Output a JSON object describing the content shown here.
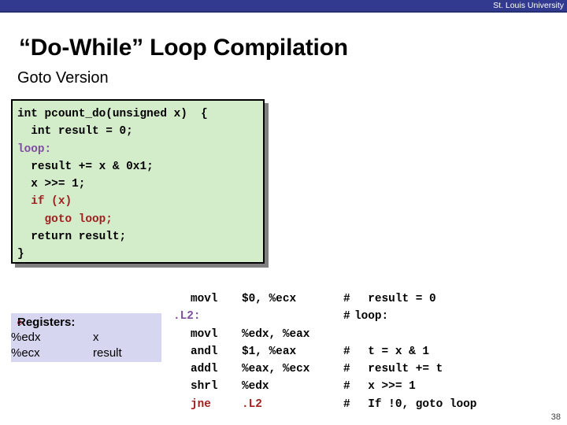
{
  "banner": {
    "institution": "St. Louis University"
  },
  "title": "“Do-While” Loop Compilation",
  "subtitle": "Goto Version",
  "colors": {
    "banner_bg": "#313a8e",
    "code_bg": "#d3ecca",
    "registers_bg": "#d6d6f0",
    "label_purple": "#7e4fa0",
    "keyword_red": "#a32020",
    "bullet_maroon": "#9c2b3f"
  },
  "code_block": {
    "language": "c",
    "lines": [
      {
        "segments": [
          {
            "text": "int pcount_do(unsigned x)  {",
            "style": "plain"
          }
        ]
      },
      {
        "segments": [
          {
            "text": "  int result = 0;",
            "style": "plain"
          }
        ]
      },
      {
        "segments": [
          {
            "text": "loop:",
            "style": "label"
          }
        ]
      },
      {
        "segments": [
          {
            "text": "  result += x & 0x1;",
            "style": "plain"
          }
        ]
      },
      {
        "segments": [
          {
            "text": "  x >>= 1;",
            "style": "plain"
          }
        ]
      },
      {
        "segments": [
          {
            "text": "  if (x)",
            "style": "keyword"
          }
        ]
      },
      {
        "segments": [
          {
            "text": "    goto loop;",
            "style": "keyword"
          }
        ]
      },
      {
        "segments": [
          {
            "text": "  return result;",
            "style": "plain"
          }
        ]
      },
      {
        "segments": [
          {
            "text": "}",
            "style": "plain"
          }
        ]
      }
    ]
  },
  "registers_callout": {
    "heading": "Registers:",
    "rows": [
      {
        "name": "%edx",
        "value": "x"
      },
      {
        "name": "%ecx",
        "value": "result"
      }
    ]
  },
  "assembly": {
    "lines": [
      {
        "label": "",
        "mnemonic": "movl",
        "operands": "$0, %ecx",
        "hash": "#",
        "comment": "  result = 0",
        "style": "plain"
      },
      {
        "label": ".L2:",
        "mnemonic": "",
        "operands": "",
        "hash": "#",
        "comment": "loop:",
        "style": "label",
        "comment_tight": true
      },
      {
        "label": "",
        "mnemonic": "movl",
        "operands": "%edx, %eax",
        "hash": "",
        "comment": "",
        "style": "plain"
      },
      {
        "label": "",
        "mnemonic": "andl",
        "operands": "$1, %eax",
        "hash": "#",
        "comment": "  t = x & 1",
        "style": "plain"
      },
      {
        "label": "",
        "mnemonic": "addl",
        "operands": "%eax, %ecx",
        "hash": "#",
        "comment": "  result += t",
        "style": "plain"
      },
      {
        "label": "",
        "mnemonic": "shrl",
        "operands": "%edx",
        "hash": "#",
        "comment": "  x >>= 1",
        "style": "plain"
      },
      {
        "label": "",
        "mnemonic": "jne",
        "operands": ".L2",
        "hash": "#",
        "comment": "  If !0, goto loop",
        "style": "keyword"
      }
    ]
  },
  "page_number": "38"
}
